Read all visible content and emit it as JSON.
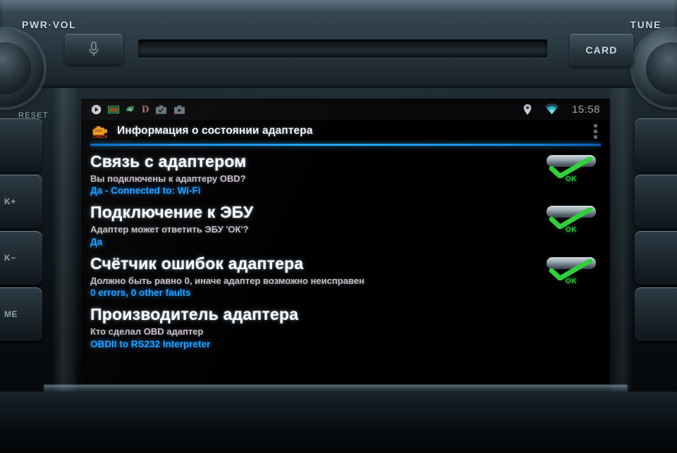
{
  "device": {
    "brand_labels": {
      "pwr_vol": "PWR·VOL",
      "tune": "TUNE",
      "reset": "RESET",
      "card": "CARD"
    },
    "left_buttons": [
      "",
      "K+",
      "K−",
      "ME"
    ],
    "right_buttons": [
      "",
      "",
      "",
      ""
    ]
  },
  "statusbar": {
    "left_icons": [
      "play-icon",
      "equalizer-icon",
      "pulse-icon",
      "letter-d-icon",
      "briefcase-check-icon",
      "briefcase-play-icon"
    ],
    "right_icons": [
      "location-pin-icon",
      "wifi-icon"
    ],
    "time": "15:58"
  },
  "actionbar": {
    "app_icon": "check-engine-icon",
    "title": "Информация о состоянии адаптера",
    "overflow_icon": "overflow-menu-icon"
  },
  "colors": {
    "accent_divider": "#25a7ec",
    "value_text": "#1ea0ff",
    "ok_green": "#2fbf3a",
    "subtitle_text": "#c0bcc8",
    "title_text": "#ffffff",
    "time_text": "#b9a8b4"
  },
  "rows": [
    {
      "title": "Связь с адаптером",
      "subtitle": "Вы подключены к адаптеру OBD?",
      "value": "Да - Connected to: Wi-Fi",
      "status": "OK",
      "has_status": true
    },
    {
      "title": "Подключение к ЭБУ",
      "subtitle": "Адаптер может ответить ЭБУ 'ОК'?",
      "value": "Да",
      "status": "OK",
      "has_status": true
    },
    {
      "title": "Счётчик ошибок адаптера",
      "subtitle": "Должно быть равно 0, иначе адаптер возможно неисправен",
      "value": "0 errors, 0 other faults",
      "status": "OK",
      "has_status": true
    },
    {
      "title": "Производитель адаптера",
      "subtitle": "Кто сделал OBD адаптер",
      "value": "OBDII to RS232 Interpreter",
      "status": "",
      "has_status": false
    }
  ]
}
